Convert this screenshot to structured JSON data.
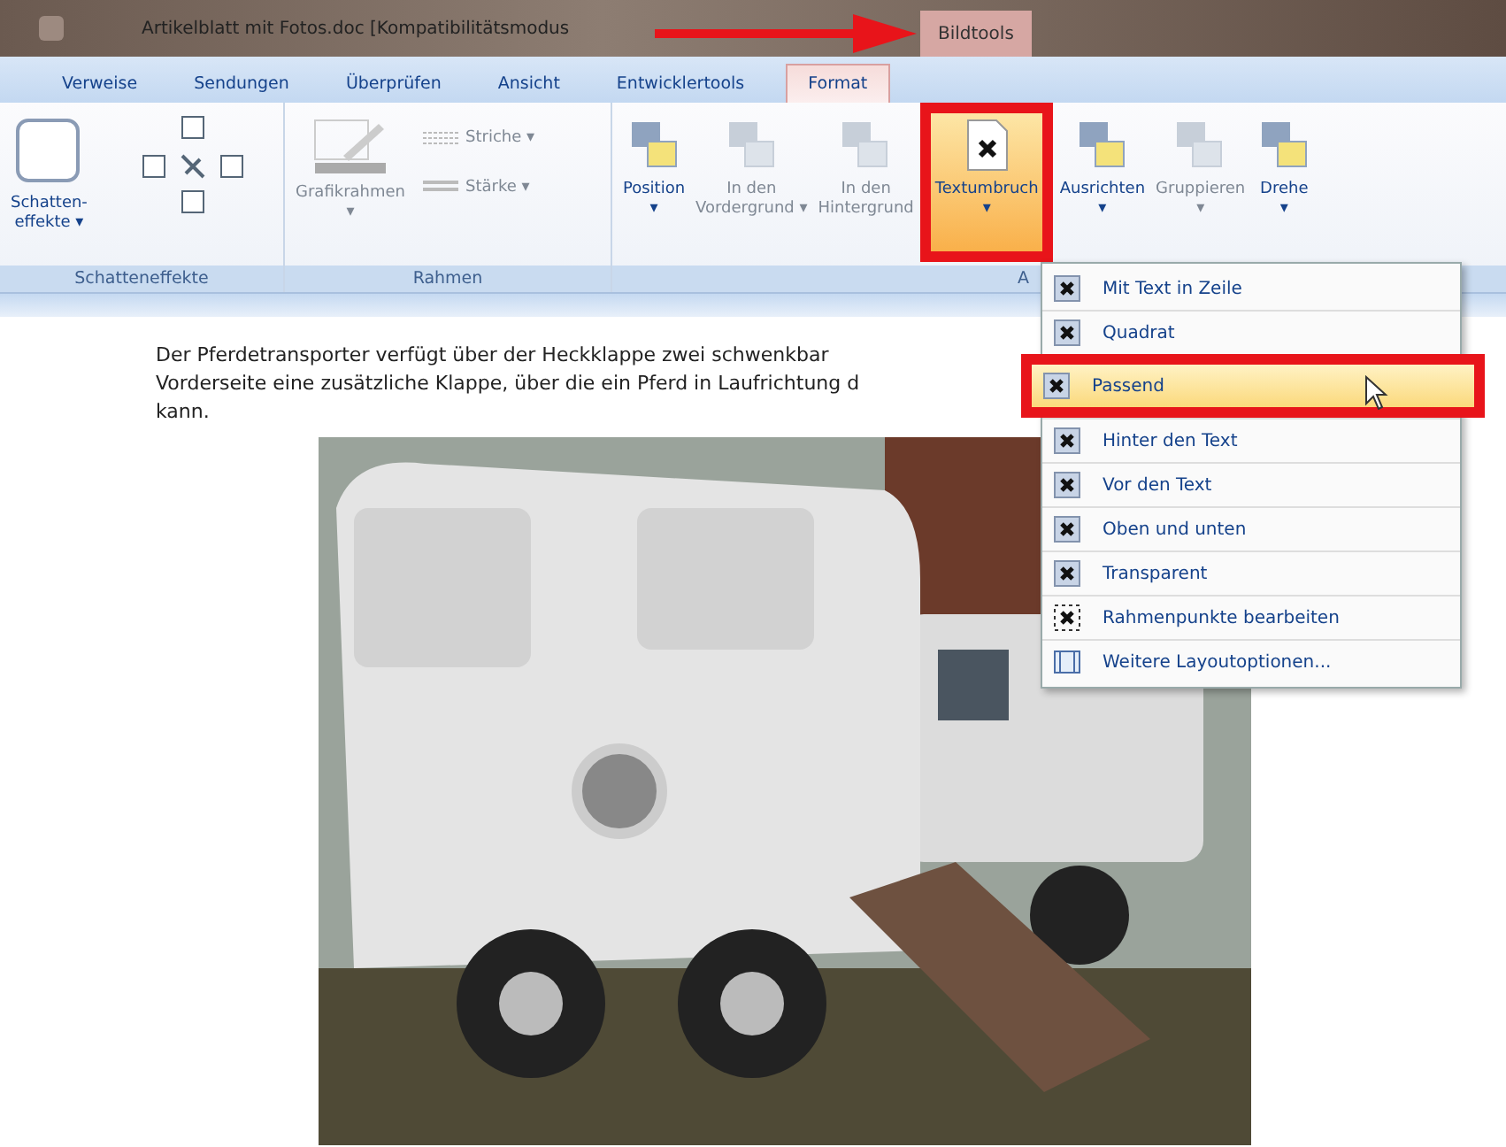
{
  "window": {
    "title": "Artikelblatt mit Fotos.doc [Kompatibilitätsmodus",
    "context_tab": "Bildtools"
  },
  "tabs": [
    {
      "label": "Verweise",
      "selected": false
    },
    {
      "label": "Sendungen",
      "selected": false
    },
    {
      "label": "Überprüfen",
      "selected": false
    },
    {
      "label": "Ansicht",
      "selected": false
    },
    {
      "label": "Entwicklertools",
      "selected": false
    },
    {
      "label": "Format",
      "selected": true
    }
  ],
  "ribbon": {
    "groups": [
      {
        "label": "Schatteneffekte",
        "kind": "shadow",
        "buttons": [
          {
            "label": "Schatten-\neffekte ▾",
            "disabled": false
          }
        ]
      },
      {
        "label": "Rahmen",
        "kind": "frame",
        "buttons": [
          {
            "label": "Grafikrahmen\n▾",
            "disabled": true
          },
          {
            "label": "Striche ▾",
            "disabled": true
          },
          {
            "label": "Stärke ▾",
            "disabled": true
          }
        ]
      },
      {
        "label": "A",
        "kind": "arrange",
        "buttons": [
          {
            "label": "Position\n▾",
            "disabled": false
          },
          {
            "label": "In den\nVordergrund ▾",
            "disabled": true
          },
          {
            "label": "In den\nHintergrund",
            "disabled": true
          },
          {
            "label": "Textumbruch\n▾",
            "disabled": false,
            "selected": true
          },
          {
            "label": "Ausrichten\n▾",
            "disabled": false,
            "selected": false
          },
          {
            "label": "Gruppieren\n▾",
            "disabled": true,
            "selected": false
          },
          {
            "label": "Drehe\n▾",
            "disabled": false,
            "selected": false
          }
        ]
      }
    ]
  },
  "document": {
    "lines": [
      "Der Pferdetransporter verfügt über der Heckklappe zwei schwenkbar",
      "Vorderseite eine zusätzliche Klappe, über die ein Pferd in Laufrichtung d",
      "kann."
    ]
  },
  "wrap_menu": {
    "items": [
      {
        "label": "Mit Text in Zeile",
        "kind": "wrap",
        "selected": false
      },
      {
        "label": "Quadrat",
        "kind": "wrap",
        "selected": false
      },
      {
        "label": "Passend",
        "kind": "wrap",
        "selected": true
      },
      {
        "label": "Hinter den Text",
        "kind": "wrap",
        "selected": false
      },
      {
        "label": "Vor den Text",
        "kind": "wrap",
        "selected": false
      },
      {
        "label": "Oben und unten",
        "kind": "wrap",
        "selected": false
      },
      {
        "label": "Transparent",
        "kind": "wrap",
        "selected": false
      },
      {
        "label": "Rahmenpunkte bearbeiten",
        "kind": "points",
        "selected": false
      },
      {
        "label": "Weitere Layoutoptionen...",
        "kind": "layout",
        "selected": false
      }
    ]
  }
}
